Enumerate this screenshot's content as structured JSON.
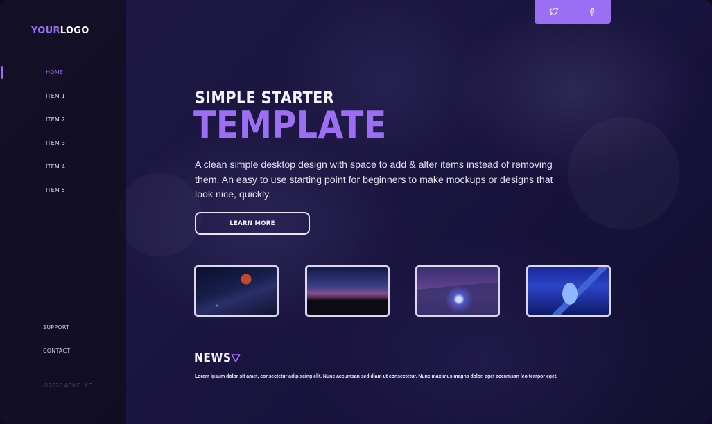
{
  "brand": {
    "logo_part1": "YOUR",
    "logo_part2": "LOGO",
    "accent_color": "#9b6ef3"
  },
  "sidebar": {
    "nav_items": [
      {
        "label": "HOME",
        "active": true
      },
      {
        "label": "ITEM 1"
      },
      {
        "label": "ITEM 2"
      },
      {
        "label": "ITEM 3"
      },
      {
        "label": "ITEM 4"
      },
      {
        "label": "ITEM  5"
      }
    ],
    "bottom_links": [
      {
        "label": "SUPPORT"
      },
      {
        "label": "CONTACT"
      }
    ],
    "copyright": "©2020 ACME LLC."
  },
  "social": {
    "icons": [
      "twitter-icon",
      "facebook-icon"
    ]
  },
  "hero": {
    "subtitle": "SIMPLE STARTER",
    "title": "TEMPLATE",
    "description": "A clean simple desktop design with space to add & alter items instead of removing them. An easy to use starting point for beginners to make mockups or designs that look nice, quickly.",
    "cta_label": "LEARN MORE"
  },
  "gallery": {
    "thumbnails": [
      {
        "subject": "blood moon over milky way"
      },
      {
        "subject": "rocky silhouettes at dusk"
      },
      {
        "subject": "glowing figure in snowy valley"
      },
      {
        "subject": "neon portrait with equipment"
      }
    ]
  },
  "news": {
    "title": "NEWS",
    "toggle_icon": "triangle-down-icon",
    "body": "Lorem ipsum dolor sit amet, consectetur adipiscing elit. Nunc accumsan sed diam ut consectetur. Nunc maximus magna dolor, eget accumsan leo tempor eget."
  }
}
